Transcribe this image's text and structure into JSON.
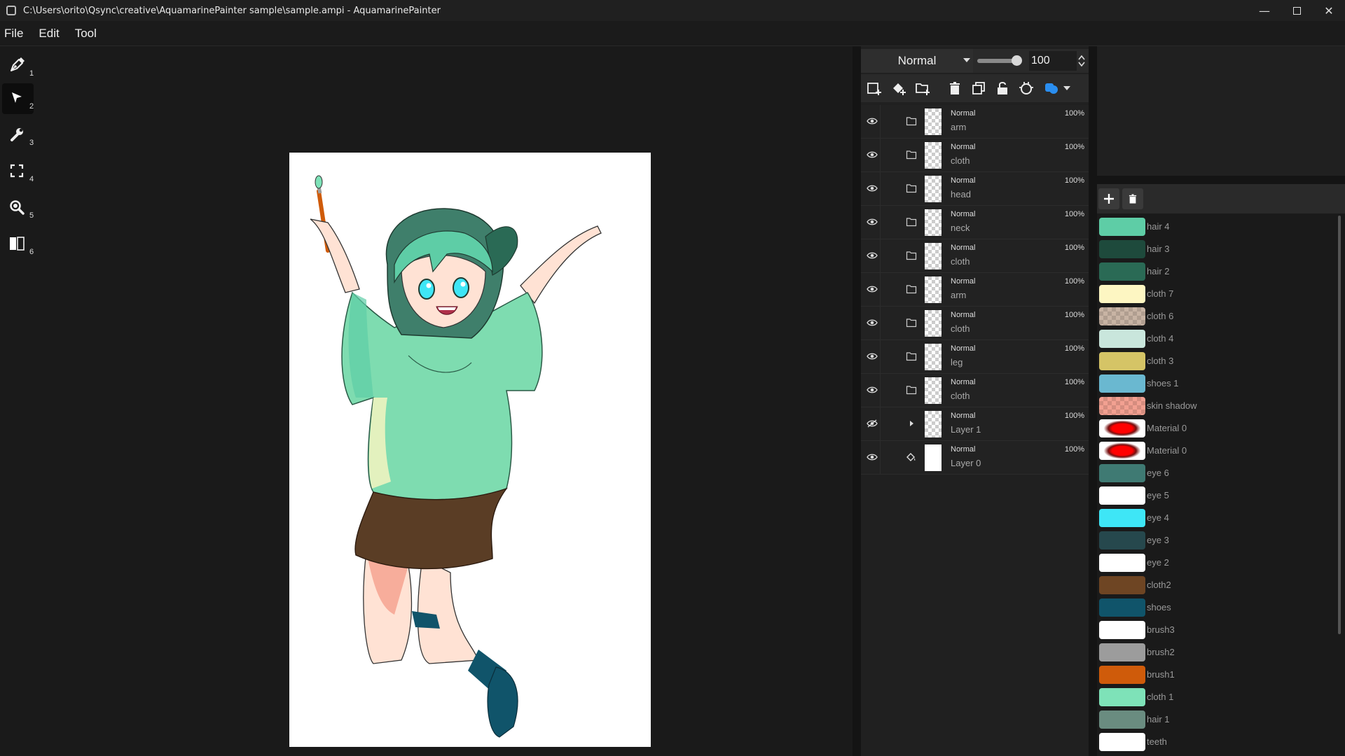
{
  "window": {
    "title": "C:\\Users\\orito\\Qsync\\creative\\AquamarinePainter sample\\sample.ampi - AquamarinePainter",
    "minimize": "—",
    "close": "✕"
  },
  "menu": [
    "File",
    "Edit",
    "Tool"
  ],
  "tools": [
    {
      "num": "1",
      "icon": "pen-icon",
      "active": false
    },
    {
      "num": "2",
      "icon": "select-arrow-icon",
      "active": true
    },
    {
      "num": "3",
      "icon": "wrench-icon",
      "active": false
    },
    {
      "num": "4",
      "icon": "transform-frame-icon",
      "active": false
    },
    {
      "num": "5",
      "icon": "zoom-icon",
      "active": false
    },
    {
      "num": "6",
      "icon": "split-view-icon",
      "active": false
    }
  ],
  "layers_panel": {
    "blend_mode": "Normal",
    "opacity_value": "100",
    "opacity_level": 1.0,
    "tools": [
      "add-layer-icon",
      "add-fill-layer-icon",
      "add-folder-icon",
      "delete-layer-icon",
      "duplicate-layer-icon",
      "lock-icon",
      "clipping-icon",
      "color-mode-icon"
    ],
    "layers": [
      {
        "blend": "Normal",
        "name": "arm",
        "opacity": "100%",
        "type": "folder",
        "thumb": "checker"
      },
      {
        "blend": "Normal",
        "name": "cloth",
        "opacity": "100%",
        "type": "folder",
        "thumb": "checker"
      },
      {
        "blend": "Normal",
        "name": "head",
        "opacity": "100%",
        "type": "folder",
        "thumb": "checker"
      },
      {
        "blend": "Normal",
        "name": "neck",
        "opacity": "100%",
        "type": "folder",
        "thumb": "checker"
      },
      {
        "blend": "Normal",
        "name": "cloth",
        "opacity": "100%",
        "type": "folder",
        "thumb": "checker"
      },
      {
        "blend": "Normal",
        "name": "arm",
        "opacity": "100%",
        "type": "folder",
        "thumb": "checker"
      },
      {
        "blend": "Normal",
        "name": "cloth",
        "opacity": "100%",
        "type": "folder",
        "thumb": "checker"
      },
      {
        "blend": "Normal",
        "name": "leg",
        "opacity": "100%",
        "type": "folder",
        "thumb": "checker"
      },
      {
        "blend": "Normal",
        "name": "cloth",
        "opacity": "100%",
        "type": "folder",
        "thumb": "checker"
      },
      {
        "blend": "Normal",
        "name": "Layer 1",
        "opacity": "100%",
        "type": "group-collapsed",
        "thumb": "checker",
        "hidden": true
      },
      {
        "blend": "Normal",
        "name": "Layer 0",
        "opacity": "100%",
        "type": "fill",
        "thumb": "white"
      }
    ]
  },
  "palette": {
    "swatches": [
      {
        "name": "hair 4",
        "color": "#5ecda6"
      },
      {
        "name": "hair 3",
        "color": "#1e4a3c"
      },
      {
        "name": "hair 2",
        "color": "#2a6a55"
      },
      {
        "name": "cloth 7",
        "color": "#fdf6c2"
      },
      {
        "name": "cloth 6",
        "color": "#c8b4a4",
        "pattern": "checker"
      },
      {
        "name": "cloth 4",
        "color": "#c9e6dc"
      },
      {
        "name": "cloth 3",
        "color": "#d5c466"
      },
      {
        "name": "shoes 1",
        "color": "#6ab8d0"
      },
      {
        "name": "skin shadow",
        "color": "#f2a091",
        "pattern": "checker"
      },
      {
        "name": "Material 0",
        "color": "#ff0000",
        "pattern": "blob"
      },
      {
        "name": "Material 0",
        "color": "#ff0000",
        "pattern": "blob"
      },
      {
        "name": "eye 6",
        "color": "#3f7a73"
      },
      {
        "name": "eye 5",
        "color": "#ffffff"
      },
      {
        "name": "eye 4",
        "color": "#3ee6f6"
      },
      {
        "name": "eye 3",
        "color": "#26484d"
      },
      {
        "name": "eye 2",
        "color": "#ffffff"
      },
      {
        "name": "cloth2",
        "color": "#6e4523"
      },
      {
        "name": "shoes",
        "color": "#10546a"
      },
      {
        "name": "brush3",
        "color": "#ffffff"
      },
      {
        "name": "brush2",
        "color": "#9c9c9c"
      },
      {
        "name": "brush1",
        "color": "#cf5b0a"
      },
      {
        "name": "cloth 1",
        "color": "#7ee2b8"
      },
      {
        "name": "hair 1",
        "color": "#6a8c80"
      },
      {
        "name": "teeth",
        "color": "#ffffff"
      }
    ]
  },
  "colors": {
    "accent_blue": "#2a8ef0",
    "sweater": "#7edcb0",
    "hair": "#3f7f6b",
    "skirt": "#5a3d25",
    "skin": "#ffe2d4",
    "skin_shadow": "#f5a08c",
    "sock": "#10546a"
  }
}
